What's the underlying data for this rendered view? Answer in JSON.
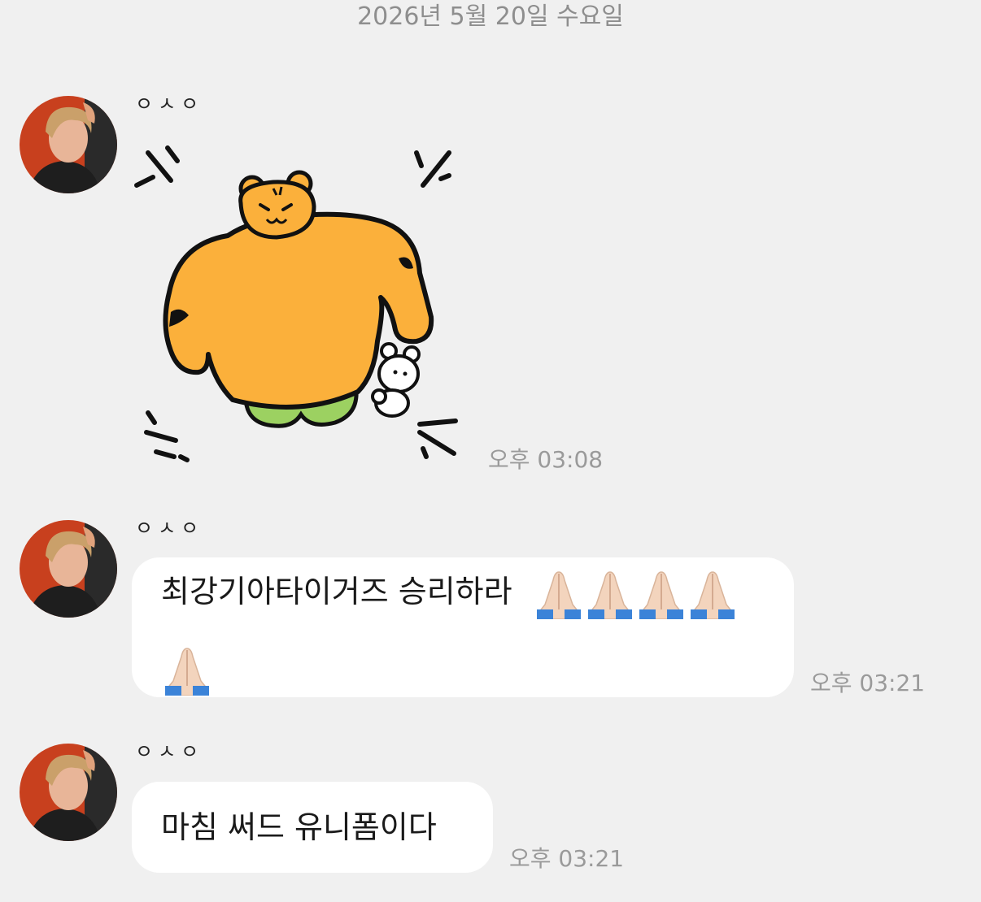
{
  "date_divider": "2026년 5월 20일 수요일",
  "messages": [
    {
      "sender": "ㅇㅅㅇ",
      "type": "sticker",
      "sticker_name": "tiger-flexing-sticker",
      "time": "오후 03:08"
    },
    {
      "sender": "ㅇㅅㅇ",
      "type": "text",
      "text": "최강기아타이거즈 승리하라",
      "emoji": "🙏🏻",
      "emoji_count": 5,
      "time": "오후 03:21"
    },
    {
      "sender": "ㅇㅅㅇ",
      "type": "text",
      "text": "마침 써드 유니폼이다",
      "time": "오후 03:21"
    }
  ],
  "colors": {
    "background": "#f0f0f0",
    "bubble": "#ffffff",
    "timestamp": "#9a9a9a",
    "tiger_orange": "#fbb03b",
    "tiger_pants": "#9cd161"
  }
}
